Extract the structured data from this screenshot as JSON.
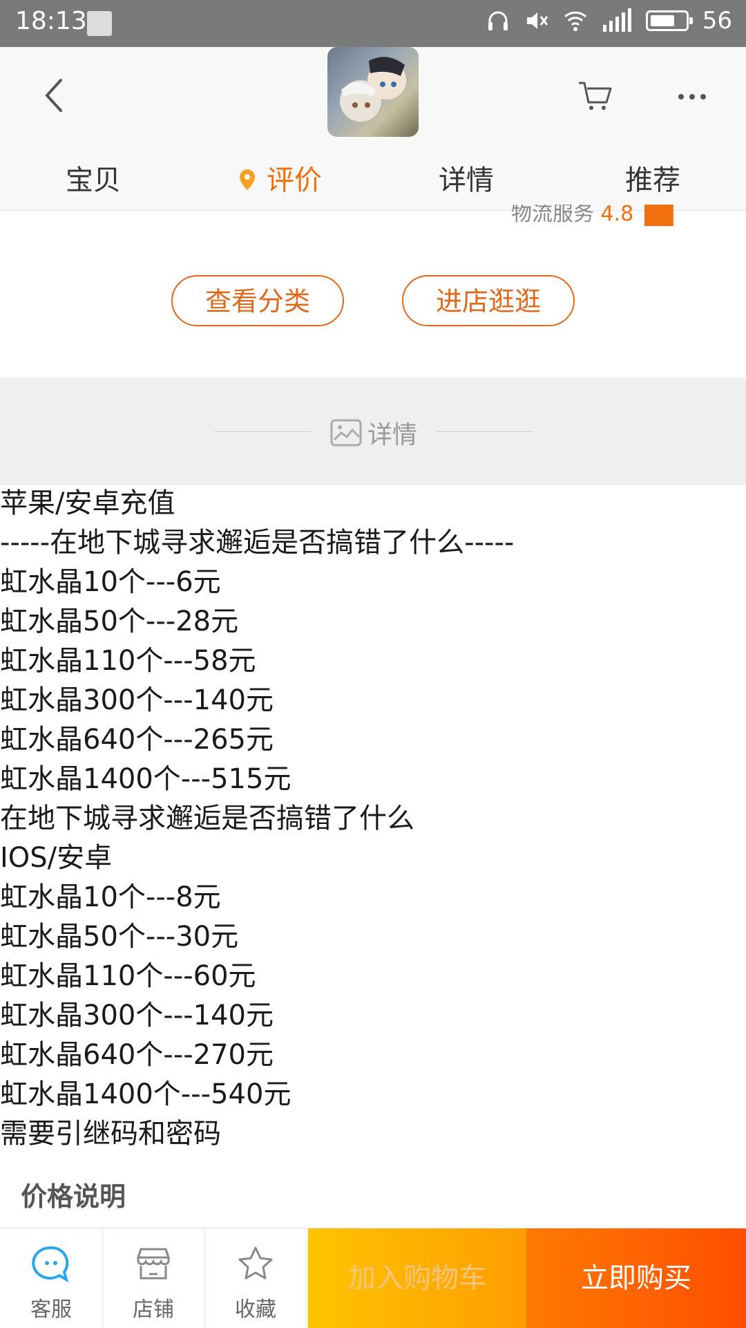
{
  "status_bar": {
    "time": "18:13",
    "network": "4G",
    "battery": "56"
  },
  "header": {
    "tabs": [
      {
        "label": "宝贝"
      },
      {
        "label": "评价"
      },
      {
        "label": "详情"
      },
      {
        "label": "推荐"
      }
    ],
    "active_tab": "评价"
  },
  "rating_partial": {
    "label": "物流服务",
    "score": "4.8"
  },
  "shop_buttons": {
    "category": "查看分类",
    "visit_store": "进店逛逛"
  },
  "details_divider": {
    "label": "详情"
  },
  "description_lines": [
    "苹果/安卓充值",
    "-----在地下城寻求邂逅是否搞错了什么-----",
    "虹水晶10个---6元",
    "虹水晶50个---28元",
    "虹水晶110个---58元",
    "虹水晶300个---140元",
    "虹水晶640个---265元",
    "虹水晶1400个---515元",
    "在地下城寻求邂逅是否搞错了什么",
    "IOS/安卓",
    "虹水晶10个---8元",
    "虹水晶50个---30元",
    "虹水晶110个---60元",
    "虹水晶300个---140元",
    "虹水晶640个---270元",
    "虹水晶1400个---540元",
    "需要引继码和密码"
  ],
  "price_note": "价格说明",
  "bottom_bar": {
    "service": "客服",
    "shop": "店铺",
    "favorite": "收藏",
    "add_to_cart": "加入购物车",
    "buy_now": "立即购买"
  },
  "colors": {
    "accent": "#f06f0e",
    "cart_button": "#ffb300",
    "buy_button": "#ff5a00"
  }
}
